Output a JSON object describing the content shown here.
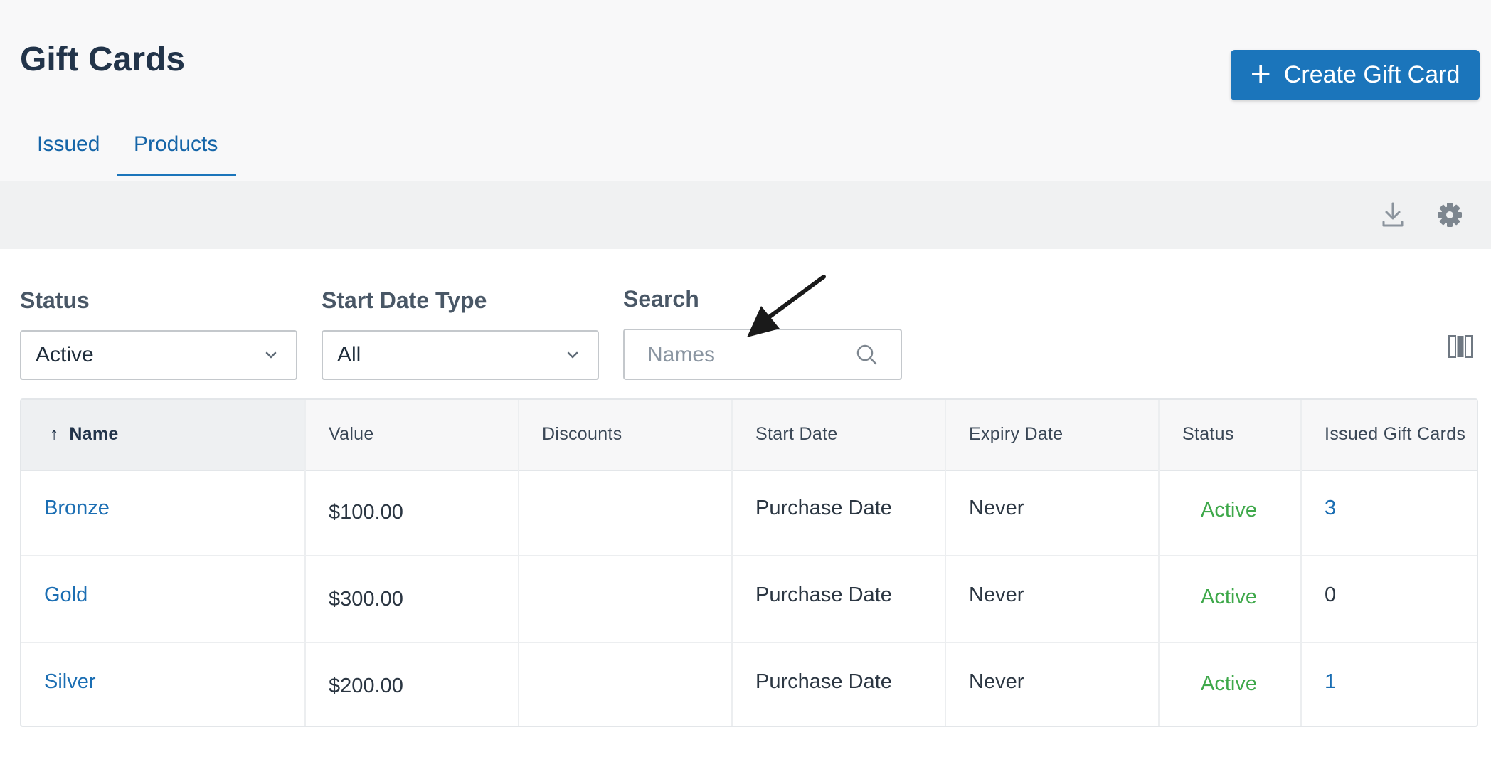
{
  "page": {
    "title": "Gift Cards",
    "create_button": "Create Gift Card"
  },
  "tabs": [
    {
      "label": "Issued"
    },
    {
      "label": "Products",
      "active": true
    }
  ],
  "toolbar": {
    "icons": [
      "download-icon",
      "settings-gear-icon"
    ]
  },
  "filters": {
    "status": {
      "label": "Status",
      "value": "Active"
    },
    "start_date_type": {
      "label": "Start Date Type",
      "value": "All"
    },
    "search": {
      "label": "Search",
      "placeholder": "Names",
      "value": ""
    }
  },
  "table": {
    "columns": [
      "Name",
      "Value",
      "Discounts",
      "Start Date",
      "Expiry Date",
      "Status",
      "Issued Gift Cards"
    ],
    "sort": {
      "column": "Name",
      "direction": "ascending",
      "indicator": "↑"
    },
    "rows": [
      {
        "name": "Bronze",
        "value": "$100.00",
        "discounts": "",
        "start_date": "Purchase Date",
        "expiry_date": "Never",
        "status": "Active",
        "issued": "3",
        "issued_linked": true
      },
      {
        "name": "Gold",
        "value": "$300.00",
        "discounts": "",
        "start_date": "Purchase Date",
        "expiry_date": "Never",
        "status": "Active",
        "issued": "0",
        "issued_linked": false
      },
      {
        "name": "Silver",
        "value": "$200.00",
        "discounts": "",
        "start_date": "Purchase Date",
        "expiry_date": "Never",
        "status": "Active",
        "issued": "1",
        "issued_linked": true
      }
    ]
  },
  "colors": {
    "primary": "#1b75bb",
    "link": "#1b6eb3",
    "status_active": "#3ea84a"
  }
}
